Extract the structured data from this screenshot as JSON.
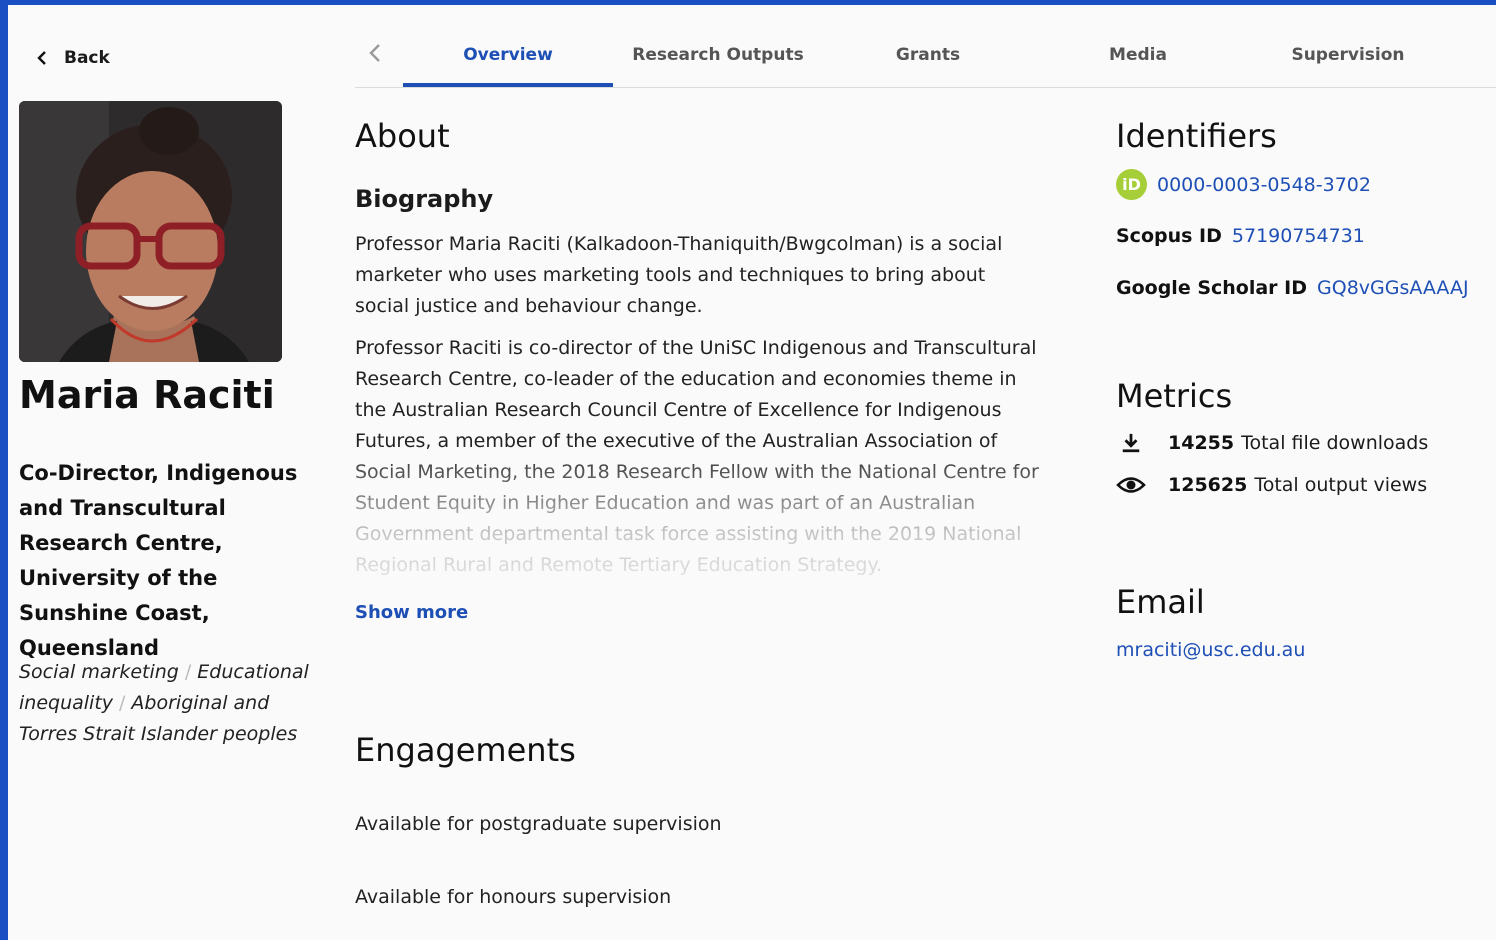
{
  "back_label": "Back",
  "profile": {
    "name": "Maria Raciti",
    "position": "Co-Director, Indigenous and Transcultural Research Centre, University of the Sunshine Coast, Queensland",
    "keywords": [
      "Social marketing",
      "Educational inequality",
      "Aboriginal and Torres Strait Islander peoples"
    ]
  },
  "tabs": [
    {
      "label": "Overview",
      "active": true
    },
    {
      "label": "Research Outputs",
      "active": false
    },
    {
      "label": "Grants",
      "active": false
    },
    {
      "label": "Media",
      "active": false
    },
    {
      "label": "Supervision",
      "active": false
    }
  ],
  "about": {
    "heading": "About",
    "biography_heading": "Biography",
    "paragraphs": [
      "Professor Maria Raciti (Kalkadoon-Thaniquith/Bwgcolman) is a social marketer who uses marketing tools and techniques to bring about social justice and behaviour change.",
      "Professor Raciti is co-director of the UniSC Indigenous and Transcultural Research Centre, co-leader of the education and economies theme in the Australian Research Council Centre of Excellence for Indigenous Futures, a member of the executive of the Australian Association of Social Marketing, the 2018 Research Fellow with the National Centre for Student Equity in Higher Education and was part of an Australian Government departmental task force assisting with the 2019 National Regional Rural and Remote Tertiary Education Strategy."
    ],
    "show_more": "Show more"
  },
  "engagements": {
    "heading": "Engagements",
    "items": [
      "Available for postgraduate supervision",
      "Available for honours supervision"
    ]
  },
  "identifiers": {
    "heading": "Identifiers",
    "orcid": "0000-0003-0548-3702",
    "orcid_icon_text": "iD",
    "scopus_label": "Scopus ID",
    "scopus_value": "57190754731",
    "scholar_label": "Google Scholar ID",
    "scholar_value": "GQ8vGGsAAAAJ"
  },
  "metrics": {
    "heading": "Metrics",
    "downloads_value": "14255",
    "downloads_label": "Total file downloads",
    "views_value": "125625",
    "views_label": "Total output views"
  },
  "email": {
    "heading": "Email",
    "address": "mraciti@usc.edu.au"
  },
  "colors": {
    "accent": "#1e4fb5",
    "frame_border": "#1a4fc4",
    "orcid": "#a6ce39"
  },
  "icons": {
    "back": "chevron-left-icon",
    "tabs_prev": "chevron-left-icon",
    "orcid": "orcid-icon",
    "downloads": "download-icon",
    "views": "eye-icon"
  }
}
